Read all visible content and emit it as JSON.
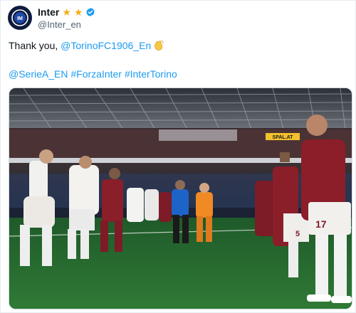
{
  "account": {
    "display_name": "Inter",
    "handle": "@Inter_en",
    "avatar": "inter-logo-icon",
    "stars": 2,
    "star_color": "#f2b01e",
    "verified_color": "#1d9bf0"
  },
  "tweet": {
    "thank_prefix": "Thank you, ",
    "mention": "@TorinoFC1906_En",
    "clap_icon": "clapping-hands-icon",
    "hashtags": [
      "@SerieA_EN",
      "#ForzaInter",
      "#InterTorino"
    ],
    "link_color": "#1d9bf0"
  },
  "media": {
    "type": "photo",
    "board_text": "SPAL.AT",
    "shirt_numbers": [
      "5",
      "17"
    ]
  }
}
